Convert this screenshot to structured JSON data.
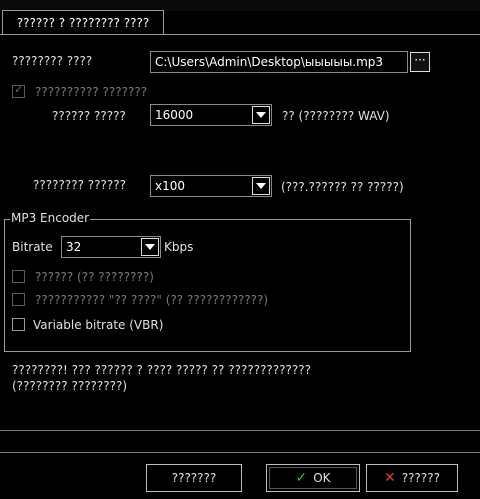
{
  "tab": {
    "label": "?????? ? ???????? ????"
  },
  "output_file": {
    "label": "???????? ????",
    "value": "C:\\Users\\Admin\\Desktop\\ыыыыы.mp3",
    "browse_label": "···"
  },
  "wav_check": {
    "label": "?????????? ???????",
    "checked": true
  },
  "sample_rate": {
    "label": "?????? ?????",
    "value": "16000",
    "hint": "?? (???????? WAV)"
  },
  "speed": {
    "label": "???????? ??????",
    "value": "x100",
    "hint": "(???.?????? ?? ?????)"
  },
  "mp3_encoder": {
    "title": "MP3 Encoder",
    "bitrate_label": "Bitrate",
    "bitrate_value": "32",
    "bitrate_unit": "Kbps",
    "option1": "?????? (?? ????????)",
    "option2": "??????????? \"?? ????\" (?? ????????????)",
    "vbr": "Variable bitrate (VBR)"
  },
  "note": {
    "line1": "????????! ??? ?????? ? ???? ????? ?? ?????????????",
    "line2": "(???????? ????????)"
  },
  "footer": {
    "help_label": "???????",
    "ok_label": "OK",
    "cancel_label": "??????"
  }
}
